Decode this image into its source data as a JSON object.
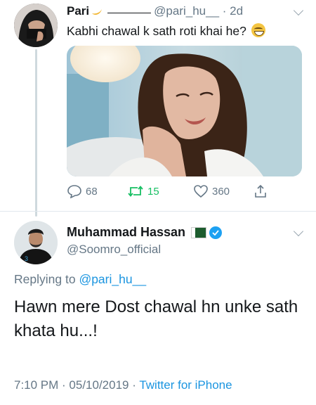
{
  "tweet1": {
    "name": "Pari",
    "handle": "@pari_hu__",
    "time": "2d",
    "text": "Kabhi chawal k sath roti khai he?",
    "emoji": "grinning-face",
    "actions": {
      "replies": "68",
      "retweets": "15",
      "likes": "360"
    }
  },
  "tweet2": {
    "name": "Muhammad Hassan",
    "handle": "@Soomro_official",
    "replying_prefix": "Replying to",
    "replying_to": "@pari_hu__",
    "text": "Hawn mere Dost chawal hn unke sath khata hu...!",
    "timestamp": "7:10 PM · 05/10/2019 ·",
    "source": "Twitter for iPhone"
  },
  "colors": {
    "link": "#1b95e0",
    "retweet": "#17bf63",
    "muted": "#657786",
    "verified": "#1da1f2"
  }
}
